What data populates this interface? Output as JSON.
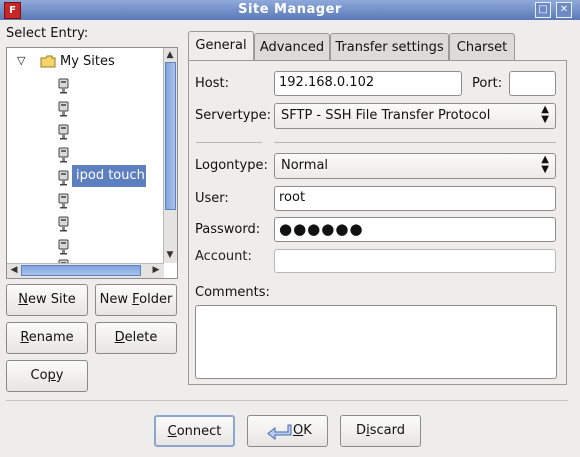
{
  "window": {
    "title": "Site Manager",
    "app_icon": "F"
  },
  "left": {
    "select_entry_label": "Select Entry:",
    "root_folder": "My Sites",
    "selected_site": "ipod touch"
  },
  "buttons": {
    "new_site": {
      "prefix": "",
      "mn": "N",
      "rest": "ew Site"
    },
    "new_folder": {
      "prefix": "New ",
      "mn": "F",
      "rest": "older"
    },
    "rename": {
      "prefix": "",
      "mn": "R",
      "rest": "ename"
    },
    "delete": {
      "prefix": "",
      "mn": "D",
      "rest": "elete"
    },
    "copy": {
      "prefix": "Co",
      "mn": "p",
      "rest": "y"
    },
    "connect": {
      "prefix": "",
      "mn": "C",
      "rest": "onnect"
    },
    "ok": {
      "prefix": "",
      "mn": "O",
      "rest": "K"
    },
    "discard": {
      "prefix": "D",
      "mn": "i",
      "rest": "scard"
    }
  },
  "tabs": [
    "General",
    "Advanced",
    "Transfer settings",
    "Charset"
  ],
  "general": {
    "host_label": "Host:",
    "host_value": "192.168.0.102",
    "port_label": "Port:",
    "port_value": "",
    "servertype_label": "Servertype:",
    "servertype_value": "SFTP - SSH File Transfer Protocol",
    "logontype_label": "Logontype:",
    "logontype_value": "Normal",
    "user_label": "User:",
    "user_value": "root",
    "password_label": "Password:",
    "password_value": "●●●●●●",
    "account_label": "Account:",
    "account_value": "",
    "comments_label": "Comments:",
    "comments_value": ""
  },
  "colors": {
    "selection": "#5d7fc0",
    "titlebar": "#6d8ac4"
  }
}
